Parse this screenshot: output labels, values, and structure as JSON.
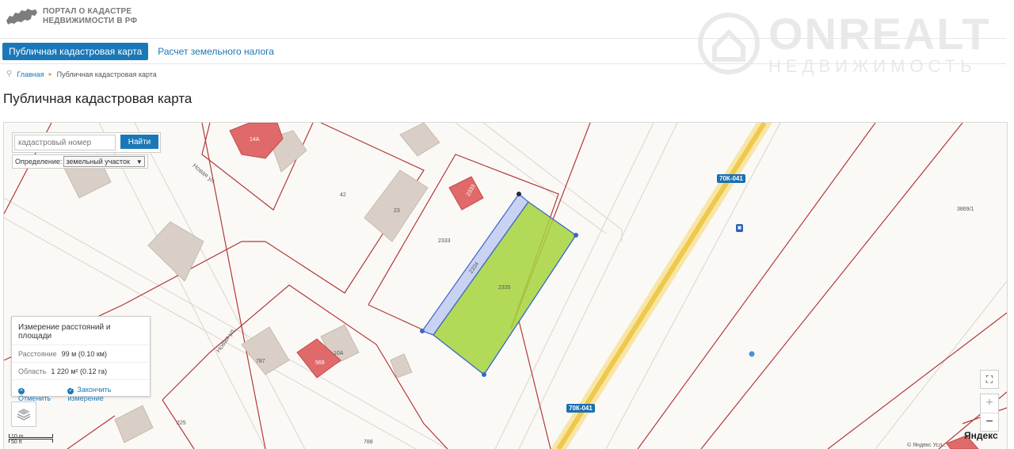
{
  "header": {
    "logo_line1": "ПОРТАЛ О КАДАСТРЕ",
    "logo_line2": "НЕДВИЖИМОСТИ В РФ",
    "watermark_main": "ONREALT",
    "watermark_sub": "НЕДВИЖИМОСТЬ"
  },
  "tabs": [
    {
      "label": "Публичная кадастровая карта",
      "active": true
    },
    {
      "label": "Расчет земельного налога",
      "active": false
    }
  ],
  "breadcrumb": {
    "home": "Главная",
    "current": "Публичная кадастровая карта"
  },
  "page_title": "Публичная кадастровая карта",
  "map": {
    "search": {
      "placeholder": "кадастровый номер",
      "button": "Найти"
    },
    "definition": {
      "label": "Определение:",
      "selected": "земельный участок"
    },
    "measure": {
      "title": "Измерение расстояний и площади",
      "distance_label": "Расстояние",
      "distance_value": "99 м (0.10 км)",
      "area_label": "Область",
      "area_value": "1 220 м² (0.12 га)",
      "cancel": "Отменить",
      "finish": "Закончить измерение"
    },
    "road_labels": [
      "70К-041",
      "70К-041"
    ],
    "street_labels": [
      "Новая ул.",
      "Новая ул."
    ],
    "parcel_labels": [
      "42",
      "23",
      "2333",
      "2334",
      "2335",
      "3869/1",
      "787",
      "10А",
      "225",
      "788"
    ],
    "building_labels": [
      "14А",
      "2333",
      "569"
    ],
    "scale": {
      "top": "10 m",
      "bottom": "50 ft"
    },
    "attribution": {
      "brand": "Яндекс",
      "terms": "© Яндекс  Усл..."
    },
    "controls": {
      "zoom_in": "+",
      "zoom_out": "−"
    }
  },
  "colors": {
    "accent": "#1a78b8",
    "parcel_border": "#b03a3a",
    "selected_fill": "#a6d33c",
    "road": "#f0c84a"
  }
}
